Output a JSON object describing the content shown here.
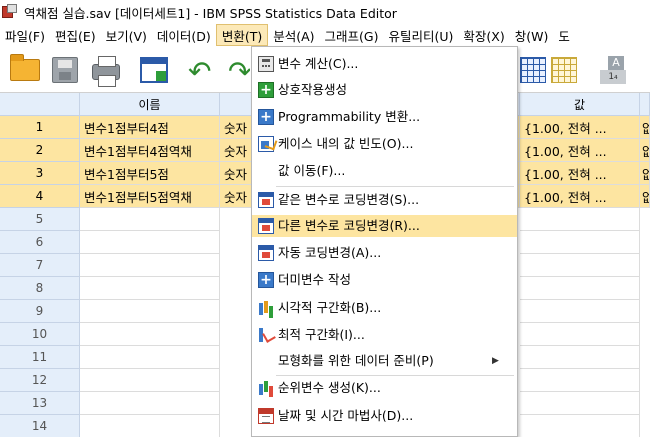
{
  "window": {
    "title": "역채점 실습.sav [데이터세트1] - IBM SPSS Statistics Data Editor"
  },
  "menubar": {
    "items": [
      "파일(F)",
      "편집(E)",
      "보기(V)",
      "데이터(D)",
      "변환(T)",
      "분석(A)",
      "그래프(G)",
      "유틸리티(U)",
      "확장(X)",
      "창(W)",
      "도"
    ]
  },
  "toolbar": {
    "icons": [
      "open-folder-icon",
      "save-icon",
      "print-icon",
      "dialog-recall-icon",
      "undo-icon",
      "redo-icon",
      "data-grid-icon",
      "data-grid-alt-icon",
      "value-labels-icon"
    ]
  },
  "grid": {
    "headers": [
      "이름",
      "",
      "값"
    ],
    "rows": [
      {
        "num": "1",
        "name": "변수1점부터4점",
        "type": "숫자",
        "values": "{1.00, 전혀 ...",
        "extra": "없"
      },
      {
        "num": "2",
        "name": "변수1점부터4점역채",
        "type": "숫자",
        "values": "{1.00, 전혀 ...",
        "extra": "없"
      },
      {
        "num": "3",
        "name": "변수1점부터5점",
        "type": "숫자",
        "values": "{1.00, 전혀 ...",
        "extra": "없"
      },
      {
        "num": "4",
        "name": "변수1점부터5점역채",
        "type": "숫자",
        "values": "{1.00, 전혀 ...",
        "extra": "없"
      }
    ],
    "empty_rows": [
      "5",
      "6",
      "7",
      "8",
      "9",
      "10",
      "11",
      "12",
      "13",
      "14"
    ]
  },
  "transform_menu": {
    "items": [
      {
        "label": "변수 계산(C)...",
        "icon": "compute-variable-icon"
      },
      {
        "label": "상호작용생성",
        "icon": "plus-green-icon"
      },
      {
        "label": "Programmability 변환...",
        "icon": "plus-blue-icon"
      },
      {
        "label": "케이스 내의 값 빈도(O)...",
        "icon": "count-values-icon"
      },
      {
        "label": "값 이동(F)...",
        "icon": ""
      },
      {
        "label": "같은 변수로 코딩변경(S)...",
        "icon": "recode-same-icon"
      },
      {
        "label": "다른 변수로 코딩변경(R)...",
        "icon": "recode-different-icon"
      },
      {
        "label": "자동 코딩변경(A)...",
        "icon": "auto-recode-icon"
      },
      {
        "label": "더미변수 작성",
        "icon": "plus-blue-icon"
      },
      {
        "label": "시각적 구간화(B)...",
        "icon": "visual-binning-icon"
      },
      {
        "label": "최적 구간화(I)...",
        "icon": "optimal-binning-icon"
      },
      {
        "label": "모형화를 위한 데이터 준비(P)",
        "icon": ""
      },
      {
        "label": "순위변수 생성(K)...",
        "icon": "rank-cases-icon"
      },
      {
        "label": "날짜 및 시간 마법사(D)...",
        "icon": "date-time-icon"
      }
    ],
    "highlighted_index": 6
  },
  "colors": {
    "highlight": "#fde5a1",
    "header_bg": "#e4eefa",
    "menu_active": "#fce9b8"
  }
}
